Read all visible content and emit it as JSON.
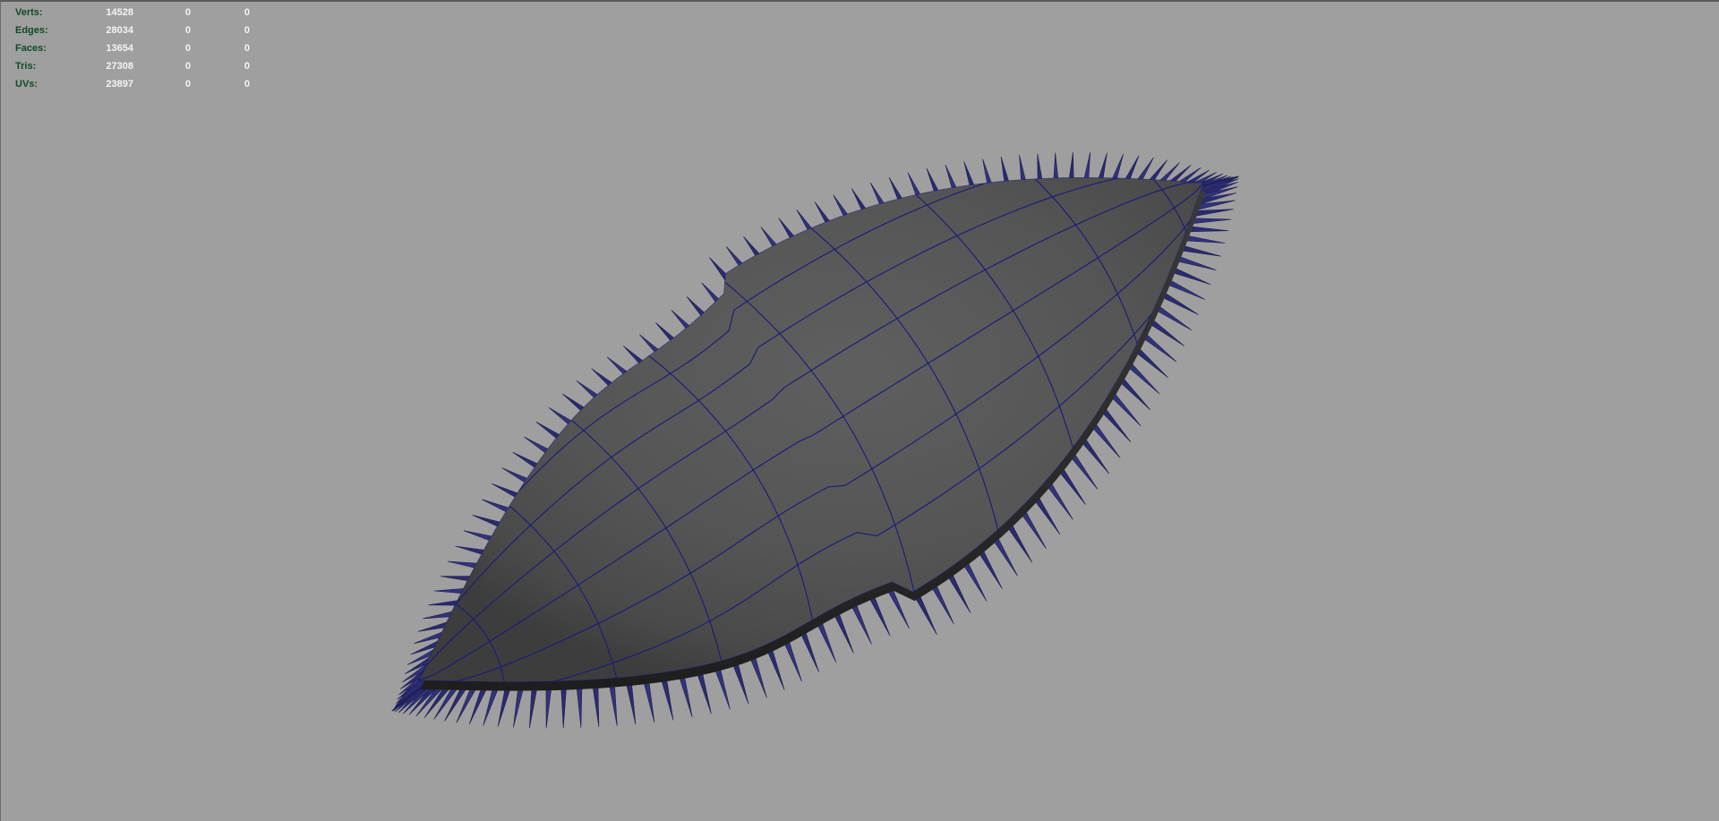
{
  "heads_up_display": {
    "poly_count": [
      {
        "label": "Verts:",
        "total": "14528",
        "selected": "0",
        "component": "0"
      },
      {
        "label": "Edges:",
        "total": "28034",
        "selected": "0",
        "component": "0"
      },
      {
        "label": "Faces:",
        "total": "13654",
        "selected": "0",
        "component": "0"
      },
      {
        "label": "Tris:",
        "total": "27308",
        "selected": "0",
        "component": "0"
      },
      {
        "label": "UVs:",
        "total": "23897",
        "selected": "0",
        "component": "0"
      }
    ]
  },
  "viewport": {
    "background_color": "#9f9f9f",
    "mesh_color": "#575757",
    "wireframe_color": "#1a1a7a",
    "spike_color": "#2b2b6e",
    "hud_label_color": "#0f4b23",
    "hud_value_color": "#f4f4f4"
  }
}
